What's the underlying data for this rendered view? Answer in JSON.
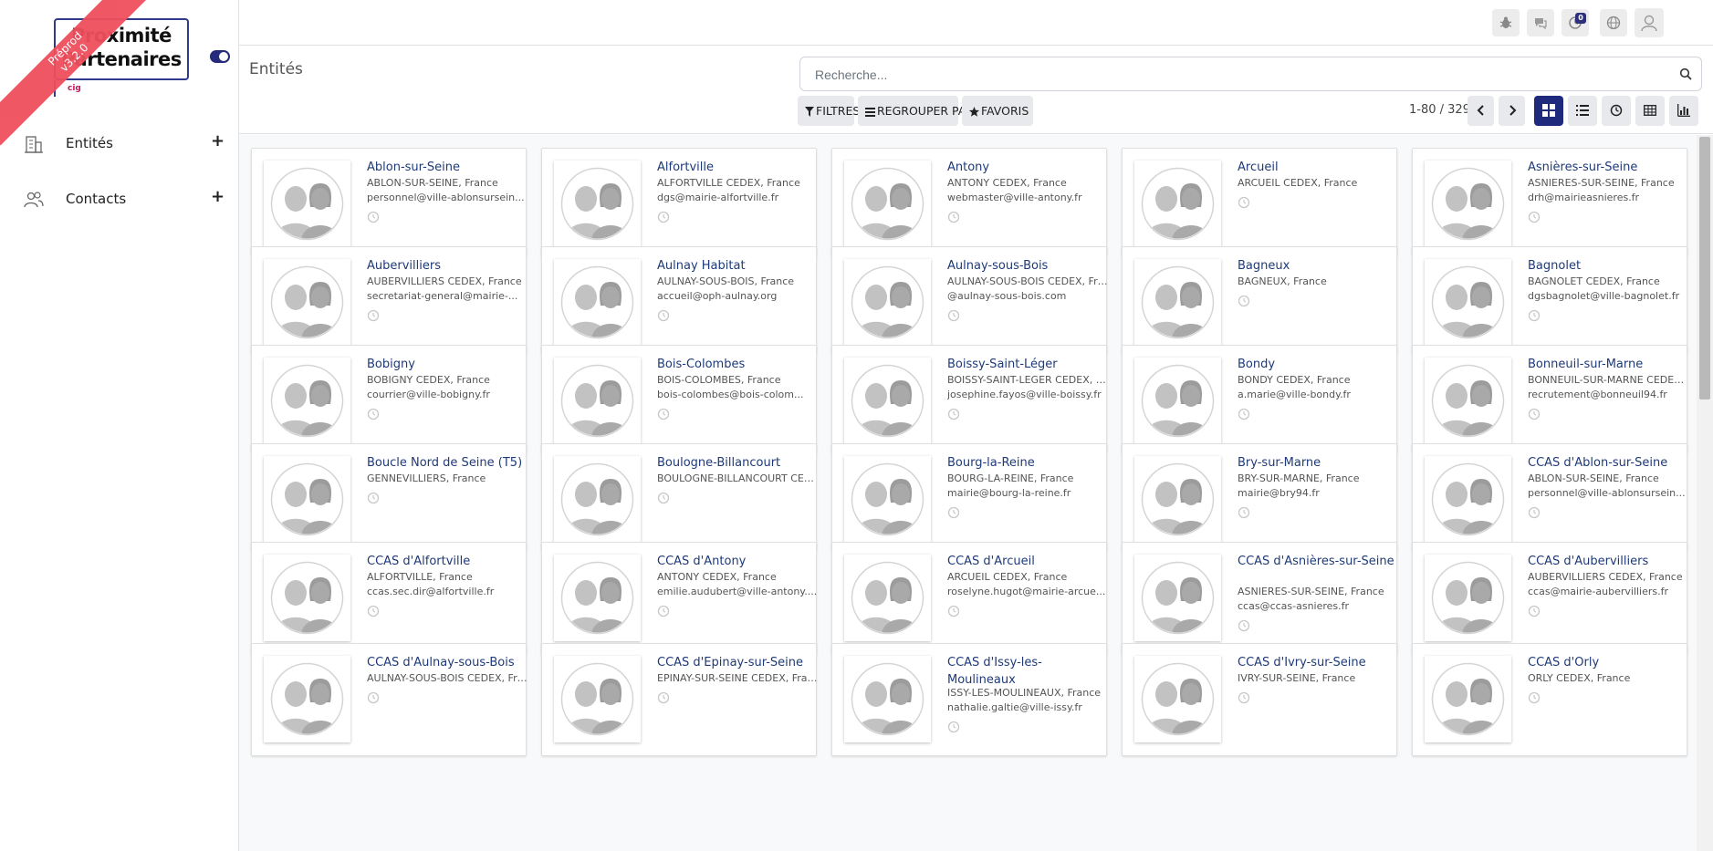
{
  "brand": {
    "line1": "Proximité",
    "line2": "Partenaires",
    "sublogo": "cig",
    "ribbon_line1": "Préprod",
    "ribbon_line2": "v3.2.0"
  },
  "sidebar": {
    "items": [
      {
        "label": "Entités",
        "icon": "building-icon"
      },
      {
        "label": "Contacts",
        "icon": "users-icon"
      }
    ]
  },
  "topbar": {
    "icons": [
      "bug-icon",
      "chat-icon",
      "activity-icon",
      "globe-icon",
      "user-avatar-icon"
    ],
    "activity_badge": "0"
  },
  "control": {
    "title": "Entités",
    "search_placeholder": "Recherche...",
    "filters_label": "FILTRES",
    "groupby_label": "REGROUPER PAR",
    "favorites_label": "FAVORIS",
    "pager": "1-80 / 329"
  },
  "cards": [
    {
      "name": "Ablon-sur-Seine",
      "location": "ABLON-SUR-SEINE, France",
      "email": "personnel@ville-ablonsursein..."
    },
    {
      "name": "Alfortville",
      "location": "ALFORTVILLE CEDEX, France",
      "email": "dgs@mairie-alfortville.fr"
    },
    {
      "name": "Antony",
      "location": "ANTONY CEDEX, France",
      "email": "webmaster@ville-antony.fr"
    },
    {
      "name": "Arcueil",
      "location": "ARCUEIL CEDEX, France",
      "email": ""
    },
    {
      "name": "Asnières-sur-Seine",
      "location": "ASNIERES-SUR-SEINE, France",
      "email": "drh@mairieasnieres.fr"
    },
    {
      "name": "Aubervilliers",
      "location": "AUBERVILLIERS CEDEX, France",
      "email": "secretariat-general@mairie-..."
    },
    {
      "name": "Aulnay Habitat",
      "location": "AULNAY-SOUS-BOIS, France",
      "email": "accueil@oph-aulnay.org"
    },
    {
      "name": "Aulnay-sous-Bois",
      "location": "AULNAY-SOUS-BOIS CEDEX, Fra...",
      "email": "@aulnay-sous-bois.com"
    },
    {
      "name": "Bagneux",
      "location": "BAGNEUX, France",
      "email": ""
    },
    {
      "name": "Bagnolet",
      "location": "BAGNOLET CEDEX, France",
      "email": "dgsbagnolet@ville-bagnolet.fr"
    },
    {
      "name": "Bobigny",
      "location": "BOBIGNY CEDEX, France",
      "email": "courrier@ville-bobigny.fr"
    },
    {
      "name": "Bois-Colombes",
      "location": "BOIS-COLOMBES, France",
      "email": "bois-colombes@bois-colom..."
    },
    {
      "name": "Boissy-Saint-Léger",
      "location": "BOISSY-SAINT-LEGER CEDEX, Fr...",
      "email": "josephine.fayos@ville-boissy.fr"
    },
    {
      "name": "Bondy",
      "location": "BONDY CEDEX, France",
      "email": "a.marie@ville-bondy.fr"
    },
    {
      "name": "Bonneuil-sur-Marne",
      "location": "BONNEUIL-SUR-MARNE CEDEX, ...",
      "email": "recrutement@bonneuil94.fr"
    },
    {
      "name": "Boucle Nord de Seine (T5)",
      "location": "GENNEVILLIERS, France",
      "email": ""
    },
    {
      "name": "Boulogne-Billancourt",
      "location": "BOULOGNE-BILLANCOURT CED...",
      "email": ""
    },
    {
      "name": "Bourg-la-Reine",
      "location": "BOURG-LA-REINE, France",
      "email": "mairie@bourg-la-reine.fr"
    },
    {
      "name": "Bry-sur-Marne",
      "location": "BRY-SUR-MARNE, France",
      "email": "mairie@bry94.fr"
    },
    {
      "name": "CCAS d'Ablon-sur-Seine",
      "location": "ABLON-SUR-SEINE, France",
      "email": "personnel@ville-ablonsursein..."
    },
    {
      "name": "CCAS d'Alfortville",
      "location": "ALFORTVILLE, France",
      "email": "ccas.sec.dir@alfortville.fr"
    },
    {
      "name": "CCAS d'Antony",
      "location": "ANTONY CEDEX, France",
      "email": "emilie.audubert@ville-antony...."
    },
    {
      "name": "CCAS d'Arcueil",
      "location": "ARCUEIL CEDEX, France",
      "email": "roselyne.hugot@mairie-arcue..."
    },
    {
      "name": "CCAS d'Asnières-sur-Seine",
      "location": "ASNIERES-SUR-SEINE, France",
      "email": "ccas@ccas-asnieres.fr"
    },
    {
      "name": "CCAS d'Aubervilliers",
      "location": "AUBERVILLIERS CEDEX, France",
      "email": "ccas@mairie-aubervilliers.fr"
    },
    {
      "name": "CCAS d'Aulnay-sous-Bois",
      "location": "AULNAY-SOUS-BOIS CEDEX, Fra...",
      "email": ""
    },
    {
      "name": "CCAS d'Epinay-sur-Seine",
      "location": "EPINAY-SUR-SEINE CEDEX, Fran...",
      "email": ""
    },
    {
      "name": "CCAS d'Issy-les-Moulineaux",
      "location": "ISSY-LES-MOULINEAUX, France",
      "email": "nathalie.galtie@ville-issy.fr"
    },
    {
      "name": "CCAS d'Ivry-sur-Seine",
      "location": "IVRY-SUR-SEINE, France",
      "email": ""
    },
    {
      "name": "CCAS d'Orly",
      "location": "ORLY CEDEX, France",
      "email": ""
    }
  ]
}
